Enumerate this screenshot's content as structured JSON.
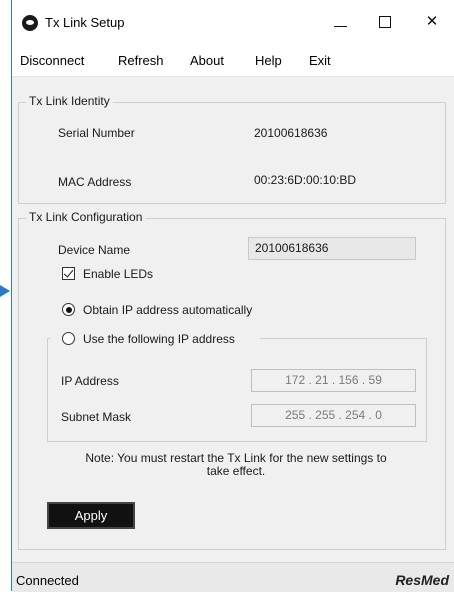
{
  "window": {
    "title": "Tx Link Setup"
  },
  "menu": {
    "items": [
      "Disconnect",
      "Refresh",
      "About",
      "Help",
      "Exit"
    ]
  },
  "identity": {
    "legend": "Tx Link Identity",
    "serial_label": "Serial Number",
    "serial_value": "20100618636",
    "mac_label": "MAC Address",
    "mac_value": "00:23:6D:00:10:BD"
  },
  "config": {
    "legend": "Tx Link Configuration",
    "device_name_label": "Device Name",
    "device_name_value": "20100618636",
    "enable_leds_label": "Enable LEDs",
    "enable_leds_checked": true,
    "obtain_auto_label": "Obtain IP address automatically",
    "use_following_label": "Use the following IP address",
    "ip_mode": "auto",
    "ip_label": "IP Address",
    "ip_value": "172 . 21 . 156 . 59",
    "subnet_label": "Subnet Mask",
    "subnet_value": "255 . 255 . 254 . 0"
  },
  "note": {
    "line1": "Note: You must restart the Tx Link for the new settings to",
    "line2": "take effect."
  },
  "apply_label": "Apply",
  "status": {
    "text": "Connected",
    "brand": "ResMed"
  },
  "colors": {
    "accent": "#2b78c9",
    "button": "#111111",
    "background": "#f0f0f0"
  }
}
